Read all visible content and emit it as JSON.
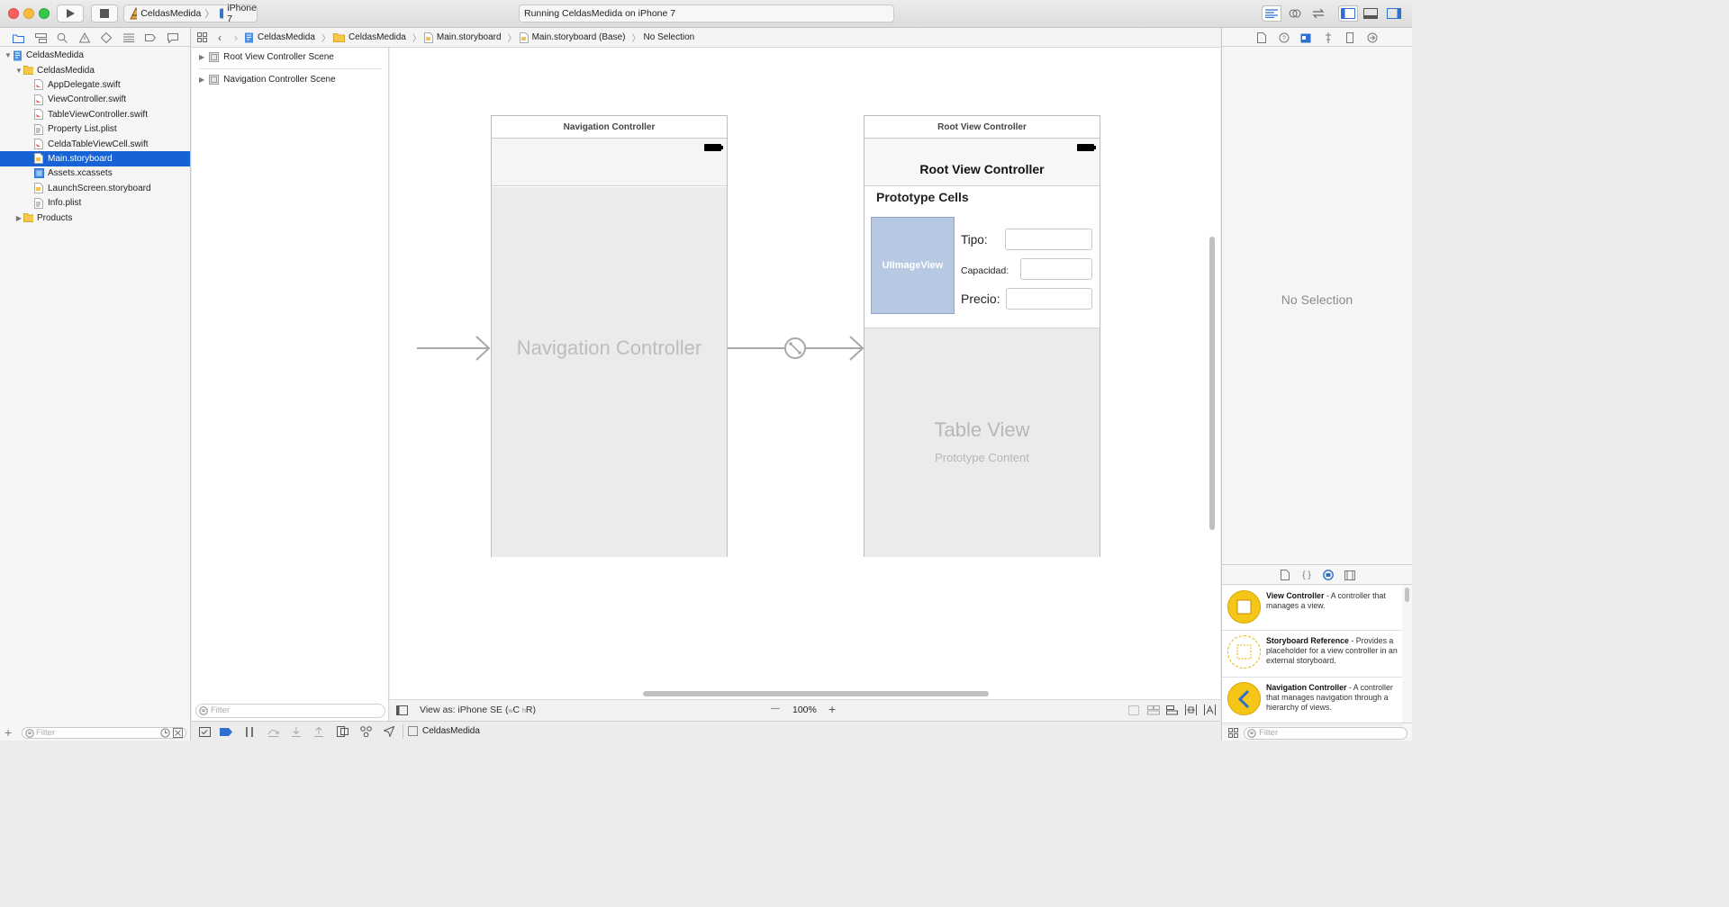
{
  "toolbar": {
    "scheme_name": "CeldasMedida",
    "device_name": "iPhone 7",
    "activity_status": "Running CeldasMedida on iPhone 7"
  },
  "navigator": {
    "tree": [
      {
        "label": "CeldasMedida",
        "icon": "project-icon",
        "level": 0,
        "expanded": true,
        "selected": false
      },
      {
        "label": "CeldasMedida",
        "icon": "folder-icon",
        "level": 1,
        "expanded": true,
        "selected": false
      },
      {
        "label": "AppDelegate.swift",
        "icon": "swift-file-icon",
        "level": 2,
        "selected": false
      },
      {
        "label": "ViewController.swift",
        "icon": "swift-file-icon",
        "level": 2,
        "selected": false
      },
      {
        "label": "TableViewController.swift",
        "icon": "swift-file-icon",
        "level": 2,
        "selected": false
      },
      {
        "label": "Property List.plist",
        "icon": "plist-file-icon",
        "level": 2,
        "selected": false
      },
      {
        "label": "CeldaTableViewCell.swift",
        "icon": "swift-file-icon",
        "level": 2,
        "selected": false
      },
      {
        "label": "Main.storyboard",
        "icon": "storyboard-file-icon",
        "level": 2,
        "selected": true
      },
      {
        "label": "Assets.xcassets",
        "icon": "assets-icon",
        "level": 2,
        "selected": false
      },
      {
        "label": "LaunchScreen.storyboard",
        "icon": "storyboard-file-icon",
        "level": 2,
        "selected": false
      },
      {
        "label": "Info.plist",
        "icon": "plist-file-icon",
        "level": 2,
        "selected": false
      },
      {
        "label": "Products",
        "icon": "folder-icon",
        "level": 1,
        "expanded": false,
        "selected": false
      }
    ],
    "filter_placeholder": "Filter"
  },
  "jumpbar": {
    "crumbs": [
      "CeldasMedida",
      "CeldasMedida",
      "Main.storyboard",
      "Main.storyboard (Base)",
      "No Selection"
    ]
  },
  "outline": {
    "scenes": [
      "Root View Controller Scene",
      "Navigation Controller Scene"
    ],
    "filter_placeholder": "Filter"
  },
  "canvas": {
    "nav_scene": {
      "title": "Navigation Controller",
      "placeholder": "Navigation Controller"
    },
    "root_scene": {
      "title": "Root View Controller",
      "nav_title": "Root View Controller",
      "prototype_header": "Prototype Cells",
      "image_view_label": "UIImageView",
      "tipo_label": "Tipo:",
      "capacidad_label": "Capacidad:",
      "precio_label": "Precio:",
      "table_view_title": "Table View",
      "table_view_subtitle": "Prototype Content"
    },
    "view_as_label": "View as: iPhone SE (",
    "view_as_w": "w",
    "view_as_c": "C ",
    "view_as_h": "h",
    "view_as_r": "R)",
    "zoom": "100%",
    "zoom_minus": "—",
    "zoom_plus": "+"
  },
  "bottom_bar": {
    "target": "CeldasMedida"
  },
  "inspector": {
    "empty_text": "No Selection"
  },
  "library": {
    "items": [
      {
        "title": "View Controller",
        "desc": " - A controller that manages a view."
      },
      {
        "title": "Storyboard Reference",
        "desc": " - Provides a placeholder for a view controller in an external storyboard."
      },
      {
        "title": "Navigation Controller",
        "desc": " - A controller that manages navigation through a hierarchy of views."
      }
    ],
    "filter_placeholder": "Filter"
  },
  "colors": {
    "selection": "#1763d6",
    "canvas_bg": "#ffffff",
    "scene_body": "#ebebeb",
    "image_view": "#b7c8e3",
    "library_accent": "#f5c518"
  }
}
